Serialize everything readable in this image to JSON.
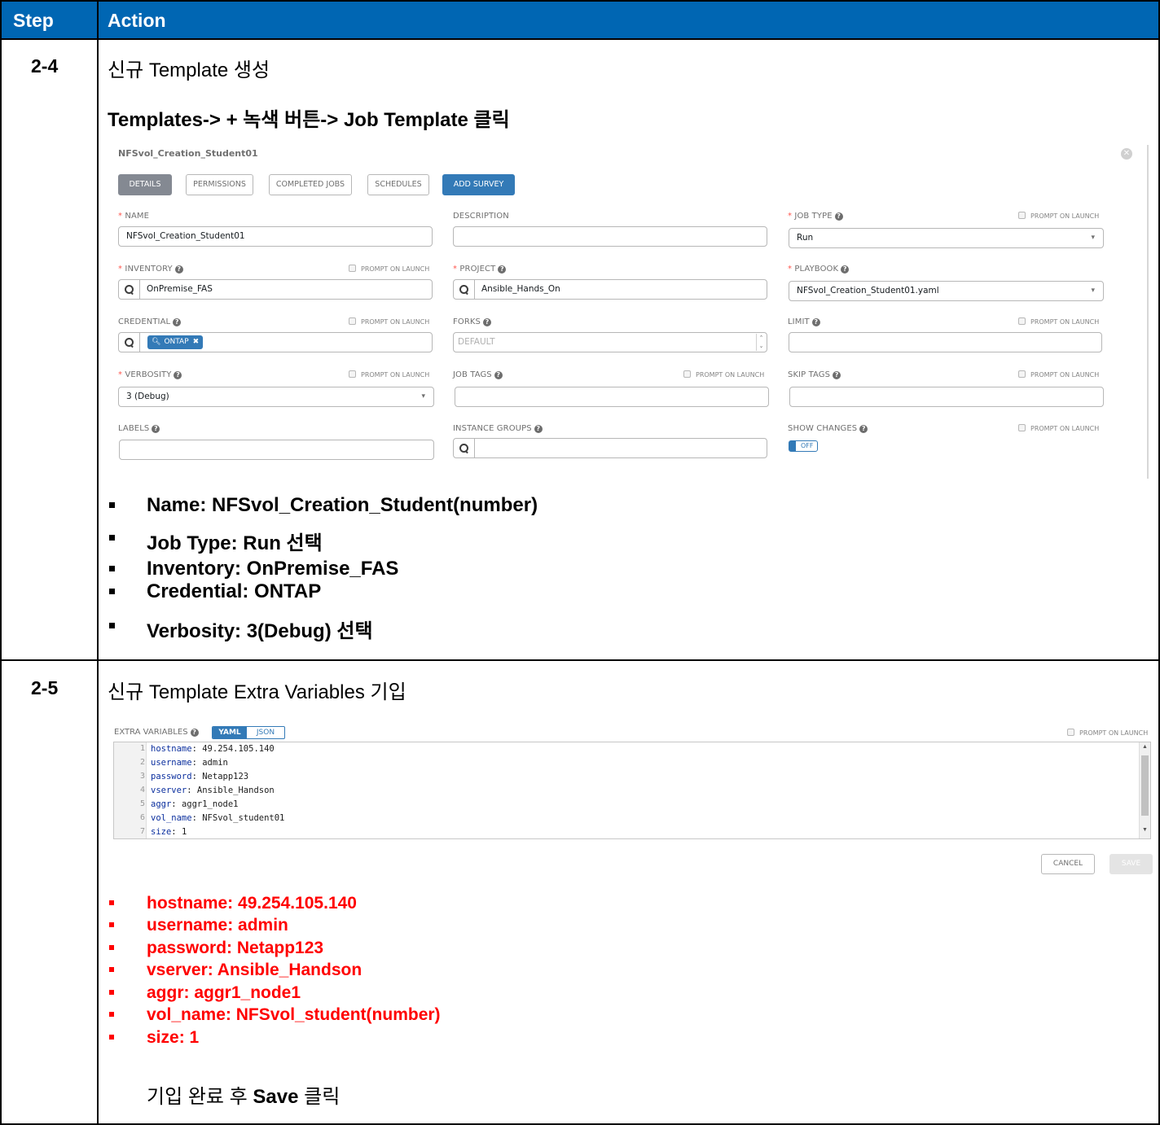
{
  "header": {
    "step": "Step",
    "action": "Action"
  },
  "steps": [
    {
      "no": "2-4",
      "title": "신규 Template 생성",
      "subtitle": "Templates-> + 녹색 버튼-> Job Template 클릭",
      "bullets": [
        "Name: NFSvol_Creation_Student(number)",
        "Job Type: Run 선택",
        "Inventory: OnPremise_FAS",
        "Credential: ONTAP",
        "Verbosity: 3(Debug) 선택"
      ]
    },
    {
      "no": "2-5",
      "title": "신규 Template Extra Variables 기입",
      "bullets": [
        "hostname: 49.254.105.140",
        "username: admin",
        "password: Netapp123",
        "vserver: Ansible_Handson",
        "aggr: aggr1_node1",
        "vol_name: NFSvol_student(number)",
        "size: 1"
      ],
      "final_pre": "기입 완료 후 ",
      "final_bold": "Save",
      "final_post": " 클릭"
    }
  ],
  "form": {
    "title": "NFSvol_Creation_Student01",
    "tabs": [
      "DETAILS",
      "PERMISSIONS",
      "COMPLETED JOBS",
      "SCHEDULES",
      "ADD SURVEY"
    ],
    "prompt_on_launch": "PROMPT ON LAUNCH",
    "name_label": "NAME",
    "name_value": "NFSvol_Creation_Student01",
    "description_label": "DESCRIPTION",
    "job_type_label": "JOB TYPE",
    "job_type_value": "Run",
    "inventory_label": "INVENTORY",
    "inventory_value": "OnPremise_FAS",
    "project_label": "PROJECT",
    "project_value": "Ansible_Hands_On",
    "playbook_label": "PLAYBOOK",
    "playbook_value": "NFSvol_Creation_Student01.yaml",
    "credential_label": "CREDENTIAL",
    "credential_value": "ONTAP",
    "forks_label": "FORKS",
    "forks_placeholder": "DEFAULT",
    "limit_label": "LIMIT",
    "verbosity_label": "VERBOSITY",
    "verbosity_value": "3 (Debug)",
    "job_tags_label": "JOB TAGS",
    "skip_tags_label": "SKIP TAGS",
    "labels_label": "LABELS",
    "instance_groups_label": "INSTANCE GROUPS",
    "show_changes_label": "SHOW CHANGES",
    "show_changes_value": "OFF"
  },
  "extra_vars": {
    "label": "EXTRA VARIABLES",
    "yaml": "YAML",
    "json": "JSON",
    "prompt_on_launch": "PROMPT ON LAUNCH",
    "lines": [
      {
        "no": "1",
        "key": "hostname",
        "val": " 49.254.105.140"
      },
      {
        "no": "2",
        "key": "username",
        "val": " admin"
      },
      {
        "no": "3",
        "key": "password",
        "val": " Netapp123"
      },
      {
        "no": "4",
        "key": "vserver",
        "val": " Ansible_Handson"
      },
      {
        "no": "5",
        "key": "aggr",
        "val": " aggr1_node1"
      },
      {
        "no": "6",
        "key": "vol_name",
        "val": " NFSvol_student01"
      },
      {
        "no": "7",
        "key": "size",
        "val": " 1"
      }
    ],
    "cancel": "CANCEL",
    "save": "SAVE"
  }
}
